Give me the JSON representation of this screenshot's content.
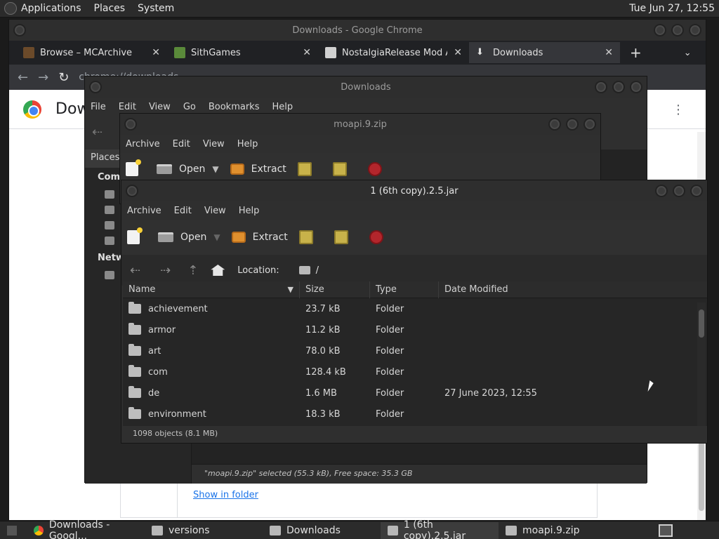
{
  "top_panel": {
    "menus": [
      "Applications",
      "Places",
      "System"
    ],
    "clock": "Tue Jun 27, 12:55"
  },
  "chrome": {
    "window_title": "Downloads - Google Chrome",
    "tabs": [
      {
        "label": "Browse – MCArchive"
      },
      {
        "label": "SithGames"
      },
      {
        "label": "NostalgiaRelease Mod Ar"
      },
      {
        "label": "Downloads"
      }
    ],
    "new_tab": "+",
    "address": "chrome://downloads",
    "page_title": "Dow",
    "show_in_folder": "Show in folder"
  },
  "files_window": {
    "title": "Downloads",
    "menus": [
      "File",
      "Edit",
      "View",
      "Go",
      "Bookmarks",
      "Help"
    ],
    "sidebar_places": "Places",
    "sidebar_computer": "Com",
    "sidebar_network": "Netw",
    "status": "\"moapi.9.zip\" selected (55.3 kB), Free space: 35.3 GB"
  },
  "roller1": {
    "title": "moapi.9.zip",
    "menus": [
      "Archive",
      "Edit",
      "View",
      "Help"
    ],
    "open_label": "Open",
    "extract_label": "Extract"
  },
  "roller2": {
    "title": "1 (6th copy).2.5.jar",
    "menus": [
      "Archive",
      "Edit",
      "View",
      "Help"
    ],
    "open_label": "Open",
    "extract_label": "Extract",
    "location_label": "Location:",
    "location_value": "/",
    "columns": [
      "Name",
      "Size",
      "Type",
      "Date Modified"
    ],
    "rows": [
      {
        "name": "achievement",
        "size": "23.7 kB",
        "type": "Folder",
        "date": ""
      },
      {
        "name": "armor",
        "size": "11.2 kB",
        "type": "Folder",
        "date": ""
      },
      {
        "name": "art",
        "size": "78.0 kB",
        "type": "Folder",
        "date": ""
      },
      {
        "name": "com",
        "size": "128.4 kB",
        "type": "Folder",
        "date": ""
      },
      {
        "name": "de",
        "size": "1.6 MB",
        "type": "Folder",
        "date": "27 June 2023, 12:55"
      },
      {
        "name": "environment",
        "size": "18.3 kB",
        "type": "Folder",
        "date": ""
      }
    ],
    "status": "1098 objects (8.1 MB)"
  },
  "taskbar": {
    "tasks": [
      {
        "label": "Downloads - Googl..."
      },
      {
        "label": "versions"
      },
      {
        "label": "Downloads"
      },
      {
        "label": "1 (6th copy).2.5.jar"
      },
      {
        "label": "moapi.9.zip"
      }
    ]
  }
}
